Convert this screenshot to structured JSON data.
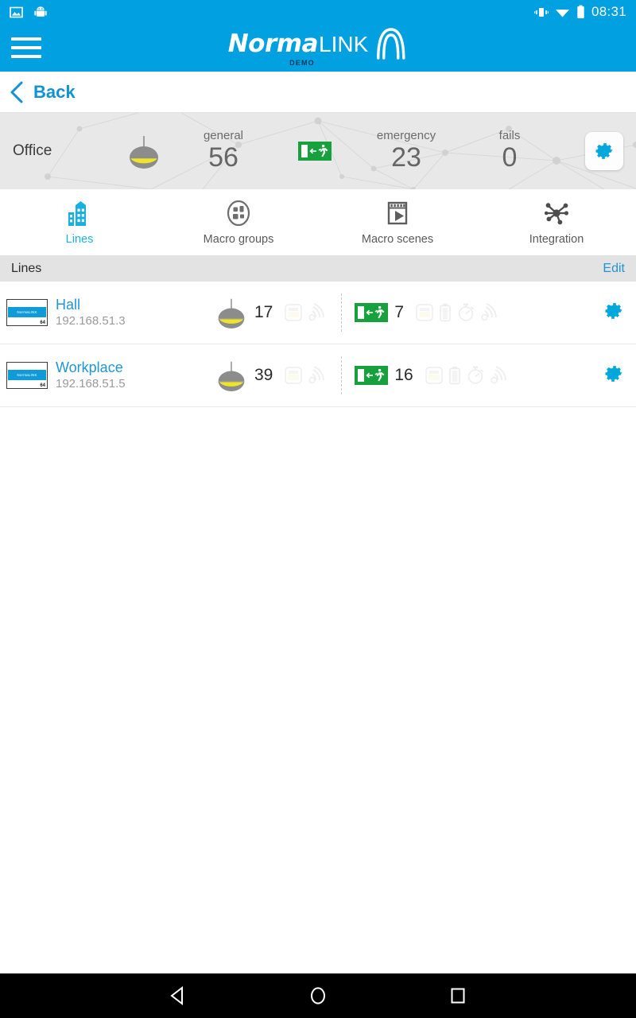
{
  "status_bar": {
    "icons": [
      "image-icon",
      "android-robot-icon",
      "vibrate-icon",
      "wifi-icon",
      "battery-icon"
    ],
    "time": "08:31"
  },
  "app_bar": {
    "menu_icon": "hamburger-menu-icon",
    "logo_primary": "Norma",
    "logo_secondary": "LINK",
    "logo_badge": "DEMO",
    "logo_mark": "arch-logo-icon",
    "background_color": "#00a0e1"
  },
  "back_bar": {
    "icon": "chevron-left-icon",
    "label": "Back",
    "color": "#1193d3"
  },
  "summary": {
    "title": "Office",
    "lamp_icon": "pendant-lamp-icon",
    "exit_icon": "emergency-exit-icon",
    "metrics": [
      {
        "label": "general",
        "value": "56"
      },
      {
        "label": "emergency",
        "value": "23"
      },
      {
        "label": "fails",
        "value": "0"
      }
    ],
    "settings_icon": "gear-icon",
    "accent_color": "#00a7dd"
  },
  "tabs": [
    {
      "label": "Lines",
      "icon": "buildings-icon",
      "active": true
    },
    {
      "label": "Macro groups",
      "icon": "macro-groups-icon",
      "active": false
    },
    {
      "label": "Macro scenes",
      "icon": "macro-scenes-icon",
      "active": false
    },
    {
      "label": "Integration",
      "icon": "integration-network-icon",
      "active": false
    }
  ],
  "section": {
    "title": "Lines",
    "edit_label": "Edit"
  },
  "lines": [
    {
      "thumb_label": "NormaLINK",
      "thumb_number": "64",
      "name": "Hall",
      "ip": "192.168.51.3",
      "general_count": "17",
      "emergency_count": "7",
      "status_icons": [
        "lamp-status-icon",
        "battery-status-icon",
        "timer-status-icon",
        "signal-status-icon"
      ],
      "settings_icon": "gear-icon"
    },
    {
      "thumb_label": "NormaLINK",
      "thumb_number": "64",
      "name": "Workplace",
      "ip": "192.168.51.5",
      "general_count": "39",
      "emergency_count": "16",
      "status_icons": [
        "lamp-status-icon",
        "battery-status-icon",
        "timer-status-icon",
        "signal-status-icon"
      ],
      "settings_icon": "gear-icon"
    }
  ],
  "nav_bar": {
    "back": "back-triangle-icon",
    "home": "home-circle-icon",
    "recents": "recents-square-icon"
  }
}
